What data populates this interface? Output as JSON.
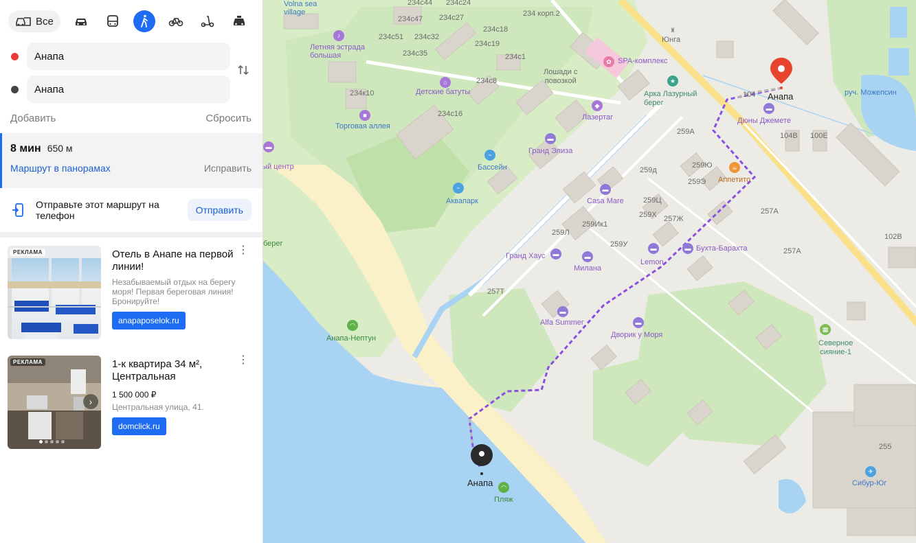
{
  "modes": {
    "all_label": "Все",
    "items": [
      {
        "name": "car",
        "icon": "car-icon"
      },
      {
        "name": "bus",
        "icon": "bus-icon"
      },
      {
        "name": "walk",
        "icon": "walk-icon",
        "active": true
      },
      {
        "name": "bike",
        "icon": "bike-icon"
      },
      {
        "name": "scooter",
        "icon": "scooter-icon"
      },
      {
        "name": "taxi",
        "icon": "taxi-icon"
      }
    ]
  },
  "route_points": {
    "from": {
      "value": "Анапа",
      "color": "#e93b3b"
    },
    "to": {
      "value": "Анапа",
      "color": "#444444"
    },
    "swap_icon": "swap-arrows-icon"
  },
  "actions": {
    "add": "Добавить",
    "reset": "Сбросить"
  },
  "route": {
    "time": "8 мин",
    "distance": "650 м",
    "panorama_link": "Маршрут в панорамах",
    "fix_link": "Исправить"
  },
  "send": {
    "text": "Отправьте этот маршрут на телефон",
    "button": "Отправить"
  },
  "ads": [
    {
      "label": "РЕКЛАМА",
      "title": "Отель в Анапе на первой линии!",
      "description": "Незабываемый отдых на берегу моря! Первая береговая линия! Бронируйте!",
      "button": "anapaposelok.ru"
    },
    {
      "label": "РЕКЛАМА",
      "title": "1-к квартира 34 м², Центральная",
      "price": "1 500 000 ₽",
      "description": "Центральная улица, 41.",
      "button": "domclick.ru"
    }
  ],
  "map": {
    "colors": {
      "route": "#8a4fe0",
      "water": "#a9d3f2",
      "beach": "#fbf1c8",
      "park": "#c9e5b4",
      "start_pin": "#e8432d",
      "end_pin": "#2a2a2a"
    },
    "labels": {
      "volna": "Volna sea\nvillage",
      "estrada": "Летняя эстрада\nбольшая",
      "batuty": "Детские батуты",
      "torg": "Торговая аллея",
      "horses": "Лошади с\nповозкой",
      "spa": "SPA-комплекс",
      "yunga": "Юнга",
      "arka": "Арка Лазурный\nберег",
      "lazertag": "Лазертаг",
      "dyuny": "Дюны Джемете",
      "grand_eliza": "Гранд Элиза",
      "bassein": "Бассейн",
      "akvapark": "Аквапарк",
      "casa": "Casa Mare",
      "appetito": "Аппетито",
      "buhta": "Бухта-Барахта",
      "lemon": "Lemon",
      "milana": "Милана",
      "grand_haus": "Гранд Хаус",
      "alfa": "Alfa Summer",
      "dvorik": "Дворик у Моря",
      "neptun": "Анапа-Нептун",
      "severnoe": "Северное\nсияние-1",
      "sibur": "Сибур-Юг",
      "plyazh": "Пляж",
      "bereg": "берег",
      "center": "ный центр",
      "stream": "руч. Можепсин",
      "start_name": "Анапа",
      "end_name": "Анапа",
      "b234c44": "234с44",
      "b234c24": "234с24",
      "b234c47": "234с47",
      "b234c27": "234с27",
      "b234korp": "234 корп.2",
      "b234c18": "234с18",
      "b234c51": "234с51",
      "b234c32": "234с32",
      "b234c19": "234с19",
      "b234c35": "234с35",
      "b234c1": "234с1",
      "b234k10": "234к10",
      "b234c8": "234с8",
      "b234c16": "234с16",
      "b259a": "259А",
      "b259yu": "259Ю",
      "b259e": "259Э",
      "b259d": "259д",
      "b259ts": "259Ц",
      "b259x": "259Х",
      "b257zh": "257Ж",
      "b259l": "259Л",
      "b259ik1": "259Ик1",
      "b259u": "259У",
      "b257t": "257Т",
      "b257a1": "257А",
      "b257a2": "257А",
      "b104": "104",
      "b104v": "104В",
      "b100e": "100Е",
      "b102v": "102В",
      "b255": "255"
    }
  }
}
